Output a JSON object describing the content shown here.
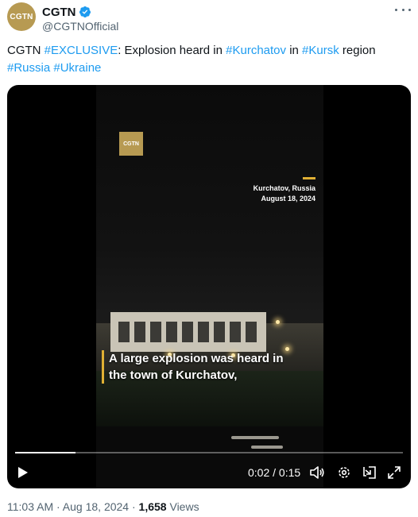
{
  "author": {
    "display_name": "CGTN",
    "handle": "@CGTNOfficial",
    "avatar_text": "CGTN",
    "avatar_color": "#b79a52",
    "verified_icon": "verified-badge-icon",
    "verified_color": "#1d9bf0"
  },
  "more_icon": "more-options-icon",
  "tweet": {
    "t1": "CGTN ",
    "tag_exclusive": "#EXCLUSIVE",
    "t2": ": Explosion heard in ",
    "tag_kurchatov": "#Kurchatov",
    "t3": " in ",
    "tag_kursk": "#Kursk",
    "t4": " region",
    "tag_russia": "#Russia",
    "tag_ukraine": "#Ukraine",
    "hashtag_color": "#1d9bf0"
  },
  "video": {
    "logo_text": "CGTN",
    "location": "Kurchatov, Russia",
    "date": "August 18, 2024",
    "subtitle_line1": "A large explosion was heard in",
    "subtitle_line2": "the town of Kurchatov,",
    "time_display": "0:02 / 0:15",
    "progress": 0.155,
    "accent_color": "#e0b034",
    "controls": {
      "play": "play-icon",
      "volume": "volume-icon",
      "settings": "settings-gear-icon",
      "dock": "dock-icon",
      "fullscreen": "fullscreen-icon"
    }
  },
  "meta": {
    "time": "11:03 AM",
    "sep1": " · ",
    "date": "Aug 18, 2024",
    "sep2": " · ",
    "views_count": "1,658",
    "views_label": " Views"
  }
}
